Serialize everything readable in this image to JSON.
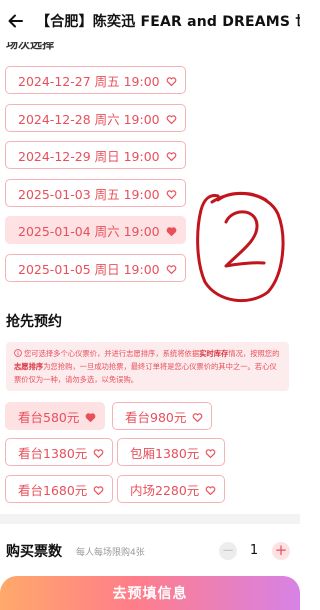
{
  "header": {
    "title": "【合肥】陈奕迅 FEAR and DREAMS 世界巡回演唱会"
  },
  "session_section": {
    "title": "场次选择"
  },
  "sessions": [
    {
      "label": "2024-12-27 周五 19:00",
      "selected": false
    },
    {
      "label": "2024-12-28 周六 19:00",
      "selected": false
    },
    {
      "label": "2024-12-29 周日 19:00",
      "selected": false
    },
    {
      "label": "2025-01-03 周五 19:00",
      "selected": false
    },
    {
      "label": "2025-01-04 周六 19:00",
      "selected": true
    },
    {
      "label": "2025-01-05 周日 19:00",
      "selected": false
    }
  ],
  "presale_section": {
    "title": "抢先预约",
    "notice": {
      "part1": "您可选择多个心仪票价，并进行志愿排序，系统将依据",
      "bold1": "实时库存",
      "part2": "情况，按照您的",
      "bold2": "志愿排序",
      "part3": "为您抢购，一旦成功抢票，最终订单将是您心仪票价的其中之一。若心仪票价仅为一种，请勿多选，以免误购。"
    }
  },
  "prices": [
    {
      "label": "看台580元",
      "selected": true
    },
    {
      "label": "看台980元",
      "selected": false
    },
    {
      "label": "看台1380元",
      "selected": false
    },
    {
      "label": "包厢1380元",
      "selected": false
    },
    {
      "label": "看台1680元",
      "selected": false
    },
    {
      "label": "内场2280元",
      "selected": false
    }
  ],
  "quantity": {
    "label": "购买票数",
    "limit": "每人每场限购4张",
    "minus": "−",
    "value": "1",
    "plus": "+"
  },
  "cta": {
    "label": "去预填信息"
  },
  "annotation": {
    "text": "2",
    "color": "#c0151c"
  },
  "colors": {
    "accent": "#e8505b",
    "chip_border": "#f6b3b7",
    "selected_bg": "#fde1e3"
  }
}
